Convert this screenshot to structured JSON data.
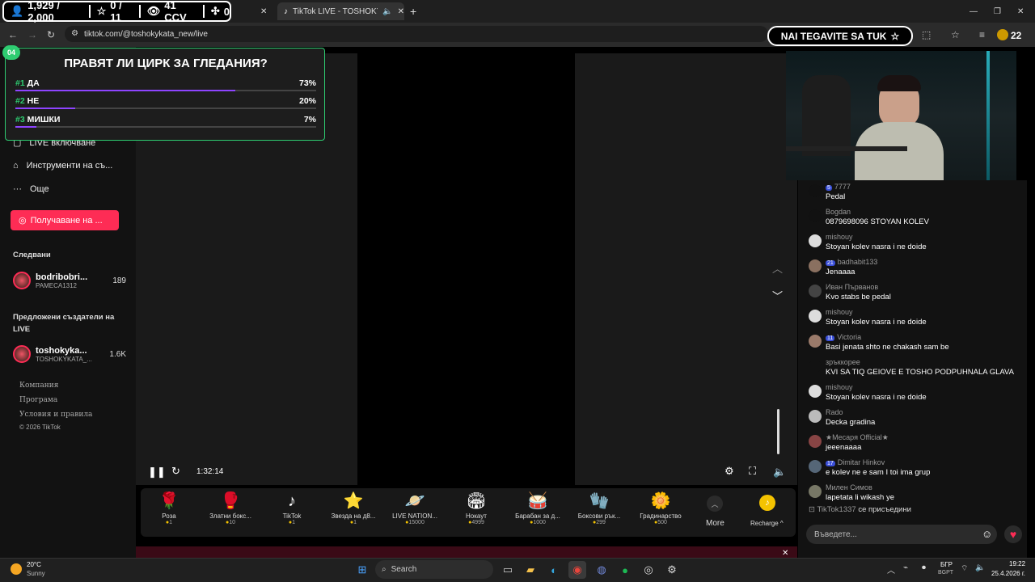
{
  "stats_bar": {
    "likes": "1,929 / 2,000",
    "stars": "0 / 11",
    "viewers": "41 CCV",
    "shares": "0"
  },
  "browser": {
    "tab_title": "TikTok LIVE - TOSHOKYKAT",
    "url": "tiktok.com/@toshokykata_new/live",
    "nai_label": "NAI TEGAVITE SA TUK",
    "nai_count": "22"
  },
  "poll": {
    "number": "04",
    "title": "ПРАВЯТ ЛИ ЦИРК ЗА ГЛЕДАНИЯ?",
    "options": [
      {
        "rank": "#1",
        "label": "ДА",
        "percent_text": "73%",
        "percent": 73
      },
      {
        "rank": "#2",
        "label": "НЕ",
        "percent_text": "20%",
        "percent": 20
      },
      {
        "rank": "#3",
        "label": "МИШКИ",
        "percent_text": "7%",
        "percent": 7
      }
    ]
  },
  "sidebar": {
    "items": [
      "LIVE включване",
      "Инструменти на съ...",
      "Още"
    ],
    "get_button": "Получаване на ...",
    "following_title": "Следвани",
    "following": [
      {
        "name": "bodribobri...",
        "sub": "PAMECA1312",
        "count": "189"
      }
    ],
    "suggested_title": "Предложени създатели на LIVE",
    "suggested": [
      {
        "name": "toshokyka...",
        "sub": "TOSHOKYKATA_...",
        "count": "1.6K"
      }
    ],
    "footer": [
      "Компания",
      "Програма",
      "Условия и правила",
      "© 2026 TikTok"
    ]
  },
  "player": {
    "time": "1:32:14"
  },
  "gifts": [
    {
      "name": "Роза",
      "price": "1",
      "icon": "🌹"
    },
    {
      "name": "Златни бокс...",
      "price": "10",
      "icon": "🥊"
    },
    {
      "name": "TikTok",
      "price": "1",
      "icon": "♪"
    },
    {
      "name": "Звезда на д8...",
      "price": "1",
      "icon": "⭐"
    },
    {
      "name": "LIVE NATION...",
      "price": "15000",
      "icon": "🪐"
    },
    {
      "name": "Нокаут",
      "price": "4999",
      "icon": "🏟"
    },
    {
      "name": "Барабан за д...",
      "price": "1000",
      "icon": "🥁"
    },
    {
      "name": "Боксови рък...",
      "price": "299",
      "icon": "🧤"
    },
    {
      "name": "Градинарство",
      "price": "500",
      "icon": "🌼"
    }
  ],
  "gift_more": "More",
  "recharge": "Recharge",
  "chat": {
    "messages": [
      {
        "badge": "5",
        "user": "7777",
        "text": "Pedal",
        "avatar": "#111111"
      },
      {
        "badge": "",
        "user": "Bogdan",
        "text": "0879698096 STOYAN KOLEV",
        "avatar": "#111111"
      },
      {
        "badge": "",
        "user": "mishouy",
        "text": "Stoyan kolev nasra i ne doide",
        "avatar": "#dddddd"
      },
      {
        "badge": "21",
        "user": "badhabit133",
        "text": "Jenaaaa",
        "avatar": "#8a7060"
      },
      {
        "badge": "",
        "user": "Иван Първанов",
        "text": "Kvo stabs be pedal",
        "avatar": "#444444"
      },
      {
        "badge": "",
        "user": "mishouy",
        "text": "Stoyan kolev nasra i ne doide",
        "avatar": "#dddddd"
      },
      {
        "badge": "11",
        "user": "Victoria",
        "text": "Basi jenata shto ne chakash sam be",
        "avatar": "#9a7a6a"
      },
      {
        "badge": "",
        "user": "зръккорее",
        "text": "KVI SA TIQ GEIOVE E TOSHO PODPUHNALA GLAVA",
        "avatar": "#121212"
      },
      {
        "badge": "",
        "user": "mishouy",
        "text": "Stoyan kolev nasra i ne doide",
        "avatar": "#dddddd"
      },
      {
        "badge": "",
        "user": "Rado",
        "text": "Decka gradina",
        "avatar": "#bbbbbb"
      },
      {
        "badge": "",
        "user": "★Месаря Official★",
        "text": "jeeenaaaa",
        "avatar": "#884444"
      },
      {
        "badge": "17",
        "user": "Dimitar Hinkov",
        "text": "e kolev ne e sam I toi ima grup",
        "avatar": "#556677"
      },
      {
        "badge": "",
        "user": "Милен Симов",
        "text": "lapetata li wikash ye",
        "avatar": "#777766"
      }
    ],
    "join_user": "TikTok1337",
    "join_text": "се присъедини",
    "input_placeholder": "Въведете..."
  },
  "taskbar": {
    "weather_temp": "20°C",
    "weather_desc": "Sunny",
    "search": "Search",
    "lang": "БГР",
    "lang_sub": "BGPT",
    "time": "19:22",
    "date": "25.4.2026 г."
  }
}
